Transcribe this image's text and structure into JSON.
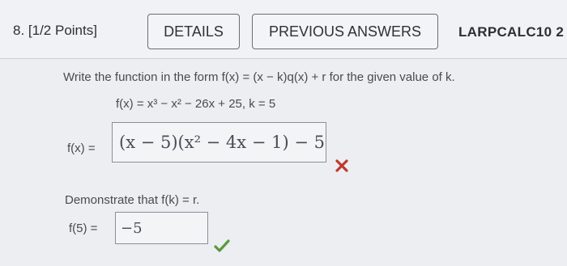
{
  "header": {
    "question_number": "8. [1/2 Points]",
    "details_button": "DETAILS",
    "previous_answers_button": "PREVIOUS ANSWERS",
    "book_code": "LARPCALC10 2"
  },
  "question": {
    "instruction": "Write the function in the form f(x) = (x − k)q(x) + r for the given value of k.",
    "given_function": "f(x) = x³ − x² − 26x + 25,  k = 5",
    "answer_label": "f(x) =",
    "answer_value": "(x − 5)(x² − 4x − 1) − 5",
    "answer_status_icon": "x-mark-icon",
    "answer_status_color": "#c0392b",
    "demonstrate_text": "Demonstrate that f(k) = r.",
    "f5_label": "f(5) =",
    "f5_value": "−5",
    "f5_status_icon": "check-mark-icon",
    "f5_status_color": "#5a9a3a"
  }
}
